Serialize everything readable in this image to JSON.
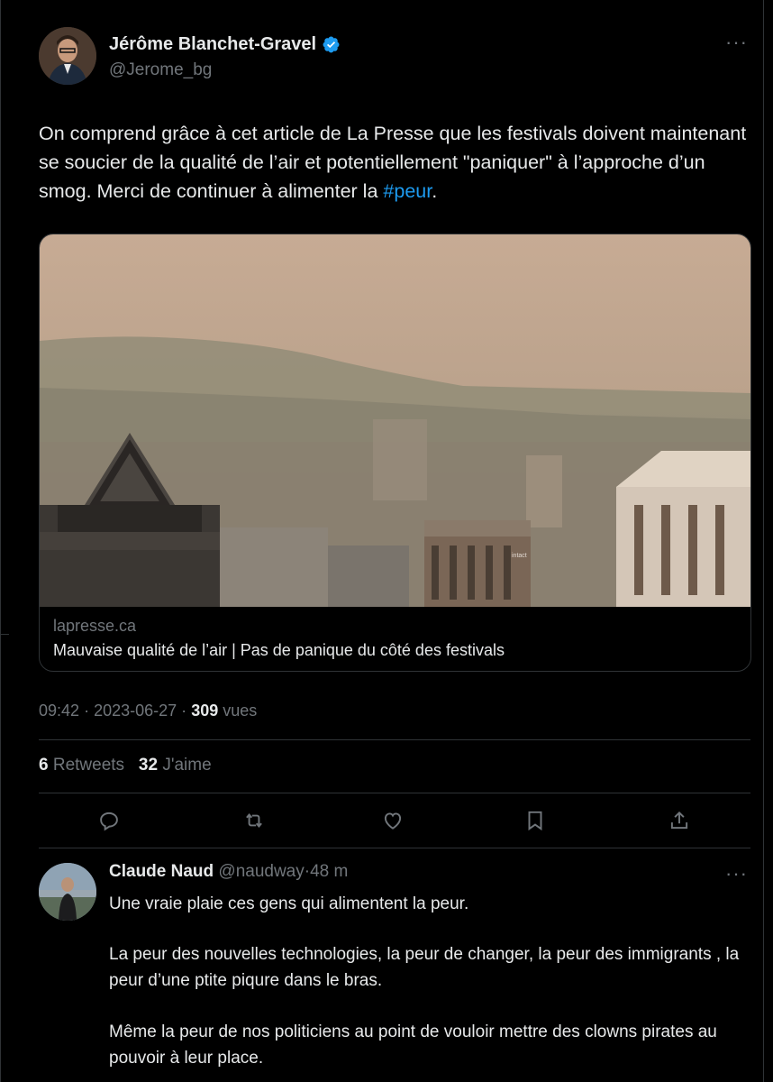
{
  "tweet": {
    "author_name": "Jérôme Blanchet-Gravel",
    "author_handle": "@Jerome_bg",
    "more_label": "···",
    "text_before_hashtag": "On comprend grâce à cet article de La Presse que les festivals doivent maintenant se soucier de la qualité de l’air et potentiellement \"paniquer\" à l’approche d’un smog. Merci de continuer à alimenter la ",
    "hashtag": "#peur",
    "text_after_hashtag": ".",
    "card": {
      "domain": "lapresse.ca",
      "title": "Mauvaise qualité de l’air | Pas de panique du côté des festivals",
      "image_sign_text": "intact"
    },
    "time": "09:42",
    "date": "2023-06-27",
    "sep": "·",
    "views_count": "309",
    "views_label": "vues",
    "retweets_count": "6",
    "retweets_label": "Retweets",
    "likes_count": "32",
    "likes_label": "J'aime",
    "actions": [
      "reply-icon",
      "retweet-icon",
      "like-icon",
      "bookmark-icon",
      "share-icon"
    ]
  },
  "reply": {
    "author_name": "Claude Naud",
    "author_handle": "@naudway",
    "sep": "·",
    "time_ago": "48 m",
    "more_label": "···",
    "paragraphs": [
      "Une vraie plaie ces gens qui alimentent la peur.",
      "La peur des nouvelles technologies, la peur de changer, la peur des immigrants , la peur d’une ptite piqure dans le bras.",
      "Même la peur de nos politiciens  au point de vouloir mettre des clowns pirates  au pouvoir à leur place."
    ]
  },
  "colors": {
    "background": "#000000",
    "text": "#e7e9ea",
    "secondary": "#71767b",
    "accent": "#1d9bf0",
    "border": "#2f3336"
  }
}
